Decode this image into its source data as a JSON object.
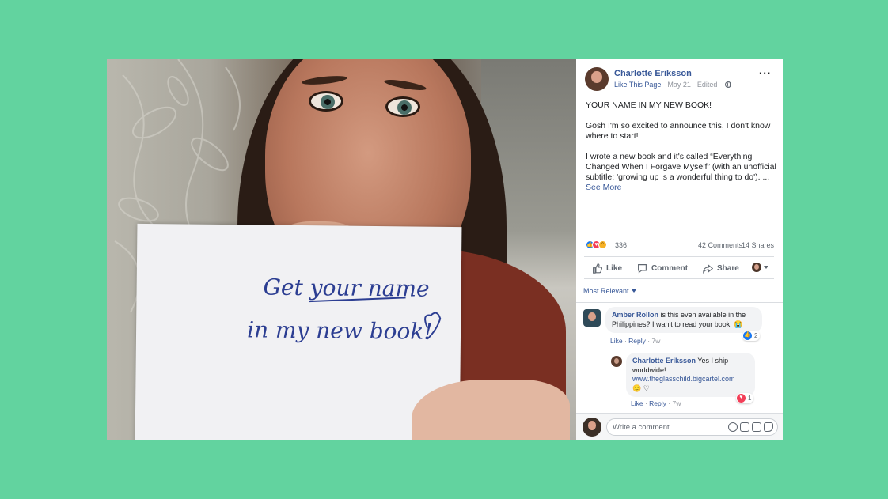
{
  "photo": {
    "handwriting_line1": "Get your name",
    "handwriting_line2": "in my new book!"
  },
  "post": {
    "author": "Charlotte Eriksson",
    "like_page": "Like This Page",
    "date": "May 21",
    "edited": "Edited",
    "visibility_icon": "globe-icon",
    "more_icon": "···",
    "paragraphs": [
      "YOUR NAME IN MY NEW BOOK!",
      "Gosh I'm so excited to announce this, I don't know where to start!",
      "I wrote a new book and it's called “Everything Changed When I Forgave Myself” (with an unofficial subtitle: 'growing up is a wonderful thing to do'). ..."
    ],
    "see_more": "See More",
    "reaction_count": "336",
    "comments_count": "42 Comments",
    "shares_count": "14 Shares",
    "reaction_types": [
      "like",
      "love",
      "haha"
    ]
  },
  "actions": {
    "like": "Like",
    "comment": "Comment",
    "share": "Share"
  },
  "sort_label": "Most Relevant",
  "comments": [
    {
      "author": "Amber Rollon",
      "text": "is this even available in the Philippines? I wan't to read your book.",
      "emoji": "😭",
      "like_label": "Like",
      "reply_label": "Reply",
      "time": "7w",
      "reaction": "like",
      "reaction_count": "2"
    },
    {
      "author": "Charlotte Eriksson",
      "text": "Yes I ship worldwide!",
      "link": "www.theglasschild.bigcartel.com",
      "emoji": "🙂 ♡",
      "like_label": "Like",
      "reply_label": "Reply",
      "time": "7w",
      "reaction": "love",
      "reaction_count": "1"
    }
  ],
  "composer": {
    "placeholder": "Write a comment..."
  },
  "colors": {
    "background": "#62d39f",
    "link_blue": "#385898",
    "like_blue": "#1877f2",
    "love_red": "#f33e58"
  }
}
